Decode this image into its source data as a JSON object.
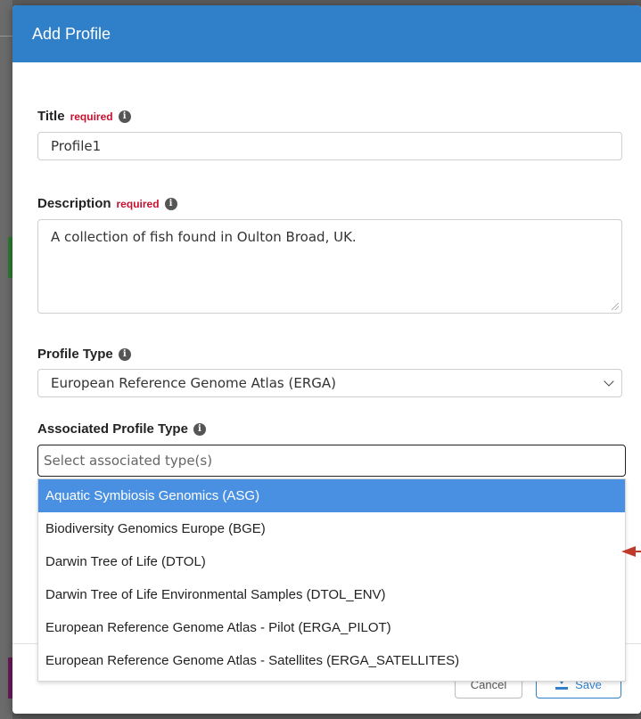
{
  "modal": {
    "title": "Add Profile"
  },
  "fields": {
    "title": {
      "label": "Title",
      "required_text": "required",
      "value": "Profile1"
    },
    "description": {
      "label": "Description",
      "required_text": "required",
      "value": "A collection of fish found in Oulton Broad, UK."
    },
    "profile_type": {
      "label": "Profile Type",
      "value": "European Reference Genome Atlas (ERGA)"
    },
    "associated_profile_type": {
      "label": "Associated Profile Type",
      "placeholder": "Select associated type(s)",
      "options": [
        "Aquatic Symbiosis Genomics (ASG)",
        "Biodiversity Genomics Europe (BGE)",
        "Darwin Tree of Life (DTOL)",
        "Darwin Tree of Life Environmental Samples (DTOL_ENV)",
        "European Reference Genome Atlas - Pilot (ERGA_PILOT)",
        "European Reference Genome Atlas - Satellites (ERGA_SATELLITES)"
      ],
      "highlighted_index": 0
    }
  },
  "buttons": {
    "cancel": "Cancel",
    "save": "Save"
  },
  "icons": {
    "info": "info-icon",
    "save": "download-icon",
    "dropdown": "chevron-down-icon"
  },
  "colors": {
    "header": "#2f80c9",
    "required": "#c8102e",
    "highlight": "#4a90e2",
    "annotation_arrow": "#c0392b"
  }
}
